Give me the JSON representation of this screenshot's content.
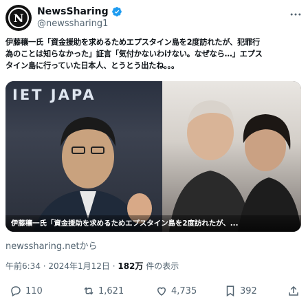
{
  "account": {
    "display_name": "NewsSharing",
    "handle": "@newssharing1",
    "avatar_letter": "N",
    "verified": true
  },
  "tweet": {
    "text_lines": [
      "伊藤穰一氏「資金援助を求めるためエプスタイン島を2度訪れたが、犯罪行",
      "為のことは知らなかった」証言「気付かないわけない。なぜなら…」エプス",
      "タイン島に行っていた日本人、とうとう出たね。。。"
    ]
  },
  "media": {
    "banner_text": "IET  JAPA",
    "caption": "伊藤穰一氏「資金援助を求めるためエプスタイン島を2度訪れたが、..."
  },
  "source": "newssharing.netから",
  "meta": {
    "time": "午前6:34",
    "date": "2024年1月12日",
    "views": "182万",
    "views_label": "件の表示"
  },
  "actions": {
    "replies": "110",
    "reposts": "1,621",
    "likes": "4,735",
    "bookmarks": "392"
  },
  "colors": {
    "verified_blue": "#1d9bf0",
    "secondary_text": "#536471"
  }
}
